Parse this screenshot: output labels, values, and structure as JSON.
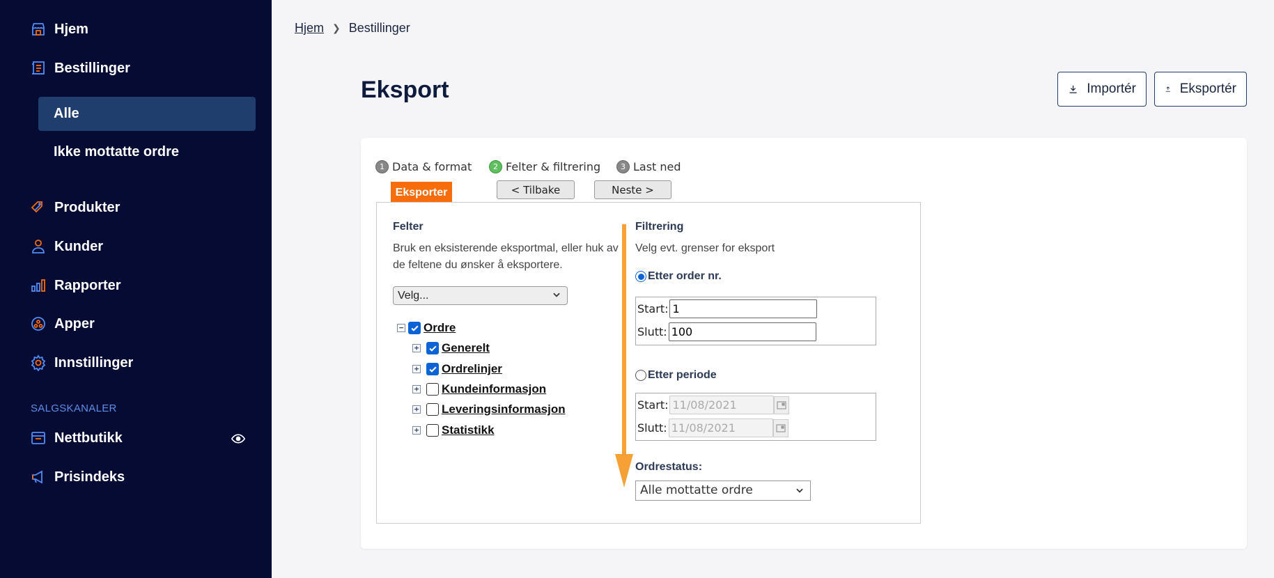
{
  "sidebar": {
    "items": {
      "home": "Hjem",
      "orders": "Bestillinger",
      "orders_all": "Alle",
      "orders_not_received": "Ikke mottatte ordre",
      "products": "Produkter",
      "customers": "Kunder",
      "reports": "Rapporter",
      "apps": "Apper",
      "settings": "Innstillinger"
    },
    "section_title": "SALGSKANALER",
    "channels": {
      "webshop": "Nettbutikk",
      "price_index": "Prisindeks"
    }
  },
  "breadcrumb": {
    "home": "Hjem",
    "current": "Bestillinger"
  },
  "header": {
    "title": "Eksport",
    "import_label": "Importér",
    "export_label": "Eksportér"
  },
  "wizard": {
    "steps": [
      {
        "num": "1",
        "label": "Data & format"
      },
      {
        "num": "2",
        "label": "Felter & filtrering"
      },
      {
        "num": "3",
        "label": "Last ned"
      }
    ],
    "export_tab": "Eksporter",
    "back_label": "< Tilbake",
    "next_label": "Neste >"
  },
  "fields": {
    "heading": "Felter",
    "description": "Bruk en eksisterende eksportmal, eller huk av de feltene du ønsker å eksportere.",
    "template_select": "Velg...",
    "tree": {
      "root": "Ordre",
      "children": [
        "Generelt",
        "Ordrelinjer",
        "Kundeinformasjon",
        "Leveringsinformasjon",
        "Statistikk"
      ]
    }
  },
  "filtering": {
    "heading": "Filtrering",
    "description": "Velg evt. grenser for eksport",
    "by_order_no": "Etter order nr.",
    "start_label": "Start:",
    "end_label": "Slutt:",
    "order_start": "1",
    "order_end": "100",
    "by_period": "Etter periode",
    "period_start": "11/08/2021",
    "period_end": "11/08/2021",
    "status_label": "Ordrestatus:",
    "status_value": "Alle mottatte ordre"
  },
  "colors": {
    "sidebar_bg": "#050b33",
    "active_item": "#1f3d6d",
    "accent_orange": "#f76c0b",
    "arrow": "#f7a035",
    "checkbox_blue": "#0b63d6"
  }
}
